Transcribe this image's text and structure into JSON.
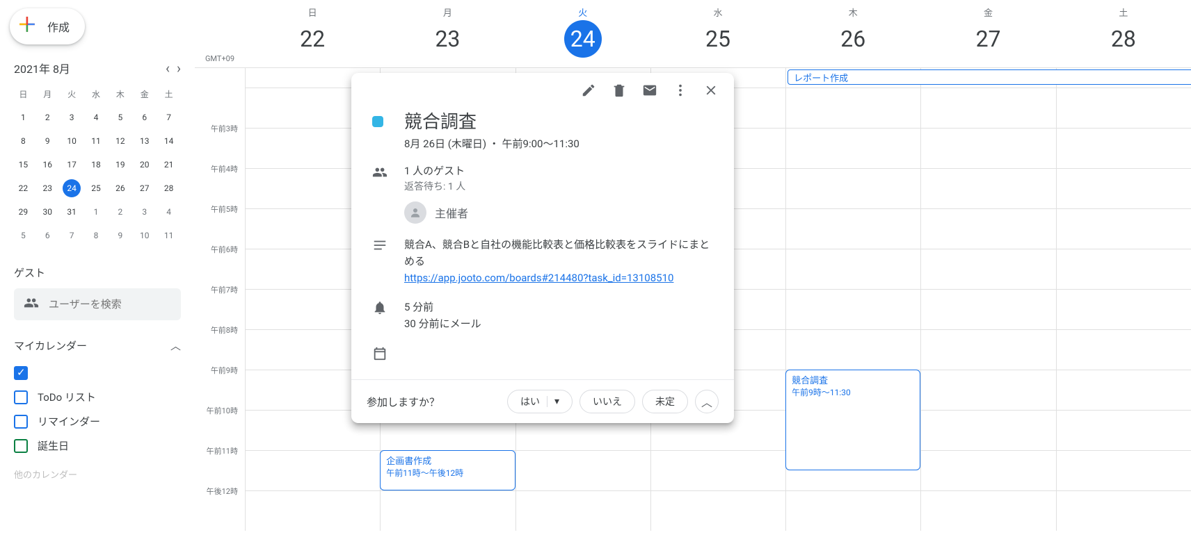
{
  "create_label": "作成",
  "timezone": "GMT+09",
  "mini": {
    "title": "2021年 8月",
    "dow": [
      "日",
      "月",
      "火",
      "水",
      "木",
      "金",
      "土"
    ],
    "weeks": [
      [
        {
          "n": "1"
        },
        {
          "n": "2"
        },
        {
          "n": "3"
        },
        {
          "n": "4"
        },
        {
          "n": "5"
        },
        {
          "n": "6"
        },
        {
          "n": "7"
        }
      ],
      [
        {
          "n": "8"
        },
        {
          "n": "9"
        },
        {
          "n": "10"
        },
        {
          "n": "11"
        },
        {
          "n": "12"
        },
        {
          "n": "13"
        },
        {
          "n": "14"
        }
      ],
      [
        {
          "n": "15"
        },
        {
          "n": "16"
        },
        {
          "n": "17"
        },
        {
          "n": "18"
        },
        {
          "n": "19"
        },
        {
          "n": "20"
        },
        {
          "n": "21"
        }
      ],
      [
        {
          "n": "22"
        },
        {
          "n": "23"
        },
        {
          "n": "24",
          "today": true
        },
        {
          "n": "25"
        },
        {
          "n": "26"
        },
        {
          "n": "27"
        },
        {
          "n": "28"
        }
      ],
      [
        {
          "n": "29"
        },
        {
          "n": "30"
        },
        {
          "n": "31"
        },
        {
          "n": "1",
          "other": true
        },
        {
          "n": "2",
          "other": true
        },
        {
          "n": "3",
          "other": true
        },
        {
          "n": "4",
          "other": true
        }
      ],
      [
        {
          "n": "5",
          "other": true
        },
        {
          "n": "6",
          "other": true
        },
        {
          "n": "7",
          "other": true
        },
        {
          "n": "8",
          "other": true
        },
        {
          "n": "9",
          "other": true
        },
        {
          "n": "10",
          "other": true
        },
        {
          "n": "11",
          "other": true
        }
      ]
    ]
  },
  "guests_label": "ゲスト",
  "guest_placeholder": "ユーザーを検索",
  "my_cal_label": "マイカレンダー",
  "other_cal_label": "他のカレンダー",
  "calendars": [
    {
      "label": "",
      "checked": true,
      "color": "#1a73e8"
    },
    {
      "label": "ToDo リスト",
      "checked": false,
      "color": "#1a73e8"
    },
    {
      "label": "リマインダー",
      "checked": false,
      "color": "#1a73e8"
    },
    {
      "label": "誕生日",
      "checked": false,
      "color": "#0b8043"
    }
  ],
  "days": [
    {
      "dow": "日",
      "num": "22"
    },
    {
      "dow": "月",
      "num": "23"
    },
    {
      "dow": "火",
      "num": "24",
      "today": true
    },
    {
      "dow": "水",
      "num": "25"
    },
    {
      "dow": "木",
      "num": "26"
    },
    {
      "dow": "金",
      "num": "27"
    },
    {
      "dow": "土",
      "num": "28"
    }
  ],
  "hours": [
    "",
    "午前3時",
    "午前4時",
    "午前5時",
    "午前6時",
    "午前7時",
    "午前8時",
    "午前9時",
    "午前10時",
    "午前11時",
    "午後12時"
  ],
  "allday_event": {
    "title": "レポート作成"
  },
  "events": {
    "planning": {
      "title": "企画書作成",
      "time": "午前11時～午後12時"
    },
    "research": {
      "title": "競合調査",
      "time": "午前9時～11:30"
    }
  },
  "pop": {
    "title": "競合調査",
    "datetime": "8月 26日 (木曜日) ・ 午前9:00～11:30",
    "guests": "1 人のゲスト",
    "guests_sub": "返答待ち: 1 人",
    "organizer": "主催者",
    "desc_text": "競合A、競合Bと自社の機能比較表と価格比較表をスライドにまとめる",
    "desc_link": "https://app.jooto.com/boards#214480?task_id=13108510",
    "rem1": "5 分前",
    "rem2": "30 分前にメール",
    "rsvp_q": "参加しますか？",
    "yes": "はい",
    "no": "いいえ",
    "maybe": "未定"
  }
}
